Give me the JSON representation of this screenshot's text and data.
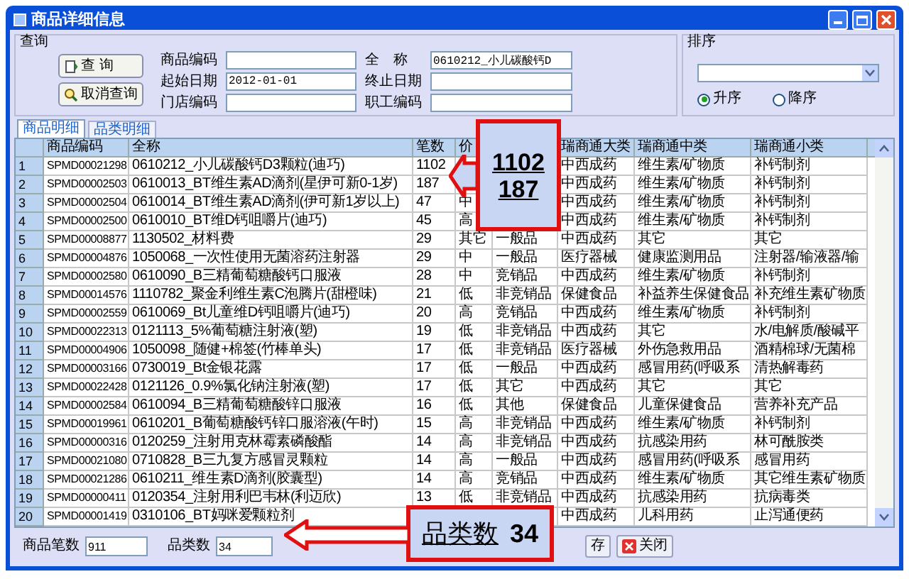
{
  "window": {
    "title": "商品详细信息"
  },
  "query": {
    "legend": "查询",
    "buttons": [
      "查 询",
      "取消查询"
    ],
    "fields": [
      {
        "label": "商品编码"
      },
      {
        "label": "起始日期",
        "value": "2012-01-01"
      },
      {
        "label": "门店编码"
      },
      {
        "label": "全　称",
        "value": "0610212_小儿碳酸钙D"
      },
      {
        "label": "终止日期"
      },
      {
        "label": "职工编码"
      }
    ]
  },
  "sort": {
    "legend": "排序",
    "options": [
      {
        "label": "升序",
        "selected": true
      },
      {
        "label": "降序",
        "selected": false
      }
    ]
  },
  "tabs": [
    {
      "label": "商品明细",
      "selected": true
    },
    {
      "label": "品类明细",
      "selected": false
    }
  ],
  "table": {
    "columns": [
      "商品编码",
      "全称",
      "笔数",
      "价",
      null,
      "瑞商通大类",
      "瑞商通中类",
      "瑞商通小类"
    ],
    "rows": [
      {
        "no": "1",
        "code": "SPMD00021298",
        "name": "0610212_小儿碳酸钙D3颗粒(迪巧)",
        "count": "1102",
        "major": "中西成药",
        "mid": "维生素/矿物质",
        "minor": "补钙制剂"
      },
      {
        "no": "2",
        "code": "SPMD00002503",
        "name": "0610013_BT维生素AD滴剂(星伊可新0-1岁)",
        "count": "187",
        "major": "中西成药",
        "mid": "维生素/矿物质",
        "minor": "补钙制剂"
      },
      {
        "no": "3",
        "code": "SPMD00002504",
        "name": "0610014_BT维生素AD滴剂(伊可新1岁以上)",
        "count": "47",
        "grade": "中",
        "major": "中西成药",
        "mid": "维生素/矿物质",
        "minor": "补钙制剂"
      },
      {
        "no": "4",
        "code": "SPMD00002500",
        "name": "0610010_BT维D钙咀嚼片(迪巧)",
        "count": "45",
        "grade": "高",
        "major": "中西成药",
        "mid": "维生素/矿物质",
        "minor": "补钙制剂"
      },
      {
        "no": "5",
        "code": "SPMD00008877",
        "name": "1130502_材料费",
        "count": "29",
        "grade": "其它",
        "column_6": "一般品",
        "major": "中西成药",
        "mid": "其它",
        "minor": "其它"
      },
      {
        "no": "6",
        "code": "SPMD00004876",
        "name": "1050068_一次性使用无菌溶药注射器",
        "count": "29",
        "grade": "中",
        "column_6": "一般品",
        "major": "医疗器械",
        "mid": "健康监测用品",
        "minor": "注射器/输液器/输"
      },
      {
        "no": "7",
        "code": "SPMD00002580",
        "name": "0610090_B三精葡萄糖酸钙口服液",
        "count": "28",
        "grade": "中",
        "column_6": "竞销品",
        "major": "中西成药",
        "mid": "维生素/矿物质",
        "minor": "补钙制剂"
      },
      {
        "no": "8",
        "code": "SPMD00014576",
        "name": "1110782_聚金利维生素C泡腾片(甜橙味)",
        "count": "21",
        "grade": "低",
        "column_6": "非竞销品",
        "major": "保健食品",
        "mid": "补益养生保健食品",
        "minor": "补充维生素矿物质"
      },
      {
        "no": "9",
        "code": "SPMD00002559",
        "name": "0610069_Bt儿童维D钙咀嚼片(迪巧)",
        "count": "20",
        "grade": "高",
        "column_6": "竞销品",
        "major": "中西成药",
        "mid": "维生素/矿物质",
        "minor": "补钙制剂"
      },
      {
        "no": "10",
        "code": "SPMD00022313",
        "name": "0121113_5%葡萄糖注射液(塑)",
        "count": "19",
        "grade": "低",
        "column_6": "非竞销品",
        "major": "中西成药",
        "mid": "其它",
        "minor": "水/电解质/酸碱平"
      },
      {
        "no": "11",
        "code": "SPMD00004906",
        "name": "1050098_随健+棉签(竹棒单头)",
        "count": "17",
        "grade": "低",
        "column_6": "非竞销品",
        "major": "医疗器械",
        "mid": "外伤急救用品",
        "minor": "酒精棉球/无菌棉"
      },
      {
        "no": "12",
        "code": "SPMD00003166",
        "name": "0730019_Bt金银花露",
        "count": "17",
        "grade": "低",
        "column_6": "一般品",
        "major": "中西成药",
        "mid": "感冒用药(呼吸系",
        "minor": "清热解毒药"
      },
      {
        "no": "13",
        "code": "SPMD00022428",
        "name": "0121126_0.9%氯化钠注射液(塑)",
        "count": "17",
        "grade": "低",
        "column_6": "其它",
        "major": "中西成药",
        "mid": "其它",
        "minor": "其它"
      },
      {
        "no": "14",
        "code": "SPMD00002584",
        "name": "0610094_B三精葡萄糖酸锌口服液",
        "count": "16",
        "grade": "低",
        "column_6": "其他",
        "major": "保健食品",
        "mid": "儿童保健食品",
        "minor": "营养补充产品"
      },
      {
        "no": "15",
        "code": "SPMD00019961",
        "name": "0610201_B葡萄糖酸钙锌口服溶液(午时)",
        "count": "15",
        "grade": "高",
        "column_6": "非竞销品",
        "major": "中西成药",
        "mid": "维生素/矿物质",
        "minor": "补钙制剂"
      },
      {
        "no": "16",
        "code": "SPMD00000316",
        "name": "0120259_注射用克林霉素磷酸酯",
        "count": "14",
        "grade": "高",
        "column_6": "非竞销品",
        "major": "中西成药",
        "mid": "抗感染用药",
        "minor": "林可酰胺类"
      },
      {
        "no": "17",
        "code": "SPMD00021080",
        "name": "0710828_B三九复方感冒灵颗粒",
        "count": "14",
        "grade": "高",
        "column_6": "一般品",
        "major": "中西成药",
        "mid": "感冒用药(呼吸系",
        "minor": "感冒用药"
      },
      {
        "no": "18",
        "code": "SPMD00021286",
        "name": "0610211_维生素D滴剂(胶囊型)",
        "count": "14",
        "grade": "高",
        "column_6": "竞销品",
        "major": "中西成药",
        "mid": "维生素/矿物质",
        "minor": "其它维生素矿物质"
      },
      {
        "no": "19",
        "code": "SPMD00000411",
        "name": "0120354_注射用利巴韦林(利迈欣)",
        "count": "13",
        "grade": "低",
        "column_6": "非竞销品",
        "major": "中西成药",
        "mid": "抗感染用药",
        "minor": "抗病毒类"
      },
      {
        "no": "20",
        "code": "SPMD00001419",
        "name": "0310106_BT妈咪爱颗粒剂",
        "major": "中西成药",
        "mid": "儿科用药",
        "minor": "止泻通便药"
      }
    ]
  },
  "footer": {
    "fields": [
      {
        "label": "商品笔数",
        "value": "911"
      },
      {
        "label": "品类数",
        "value": "34"
      }
    ],
    "buttons": [
      {
        "kind": "save",
        "label": "存"
      },
      {
        "kind": "close",
        "label": "关闭"
      }
    ]
  },
  "callouts": [
    {
      "lines": [
        "1102",
        "187"
      ]
    },
    {
      "lines": [
        "品类数",
        "34"
      ]
    }
  ]
}
